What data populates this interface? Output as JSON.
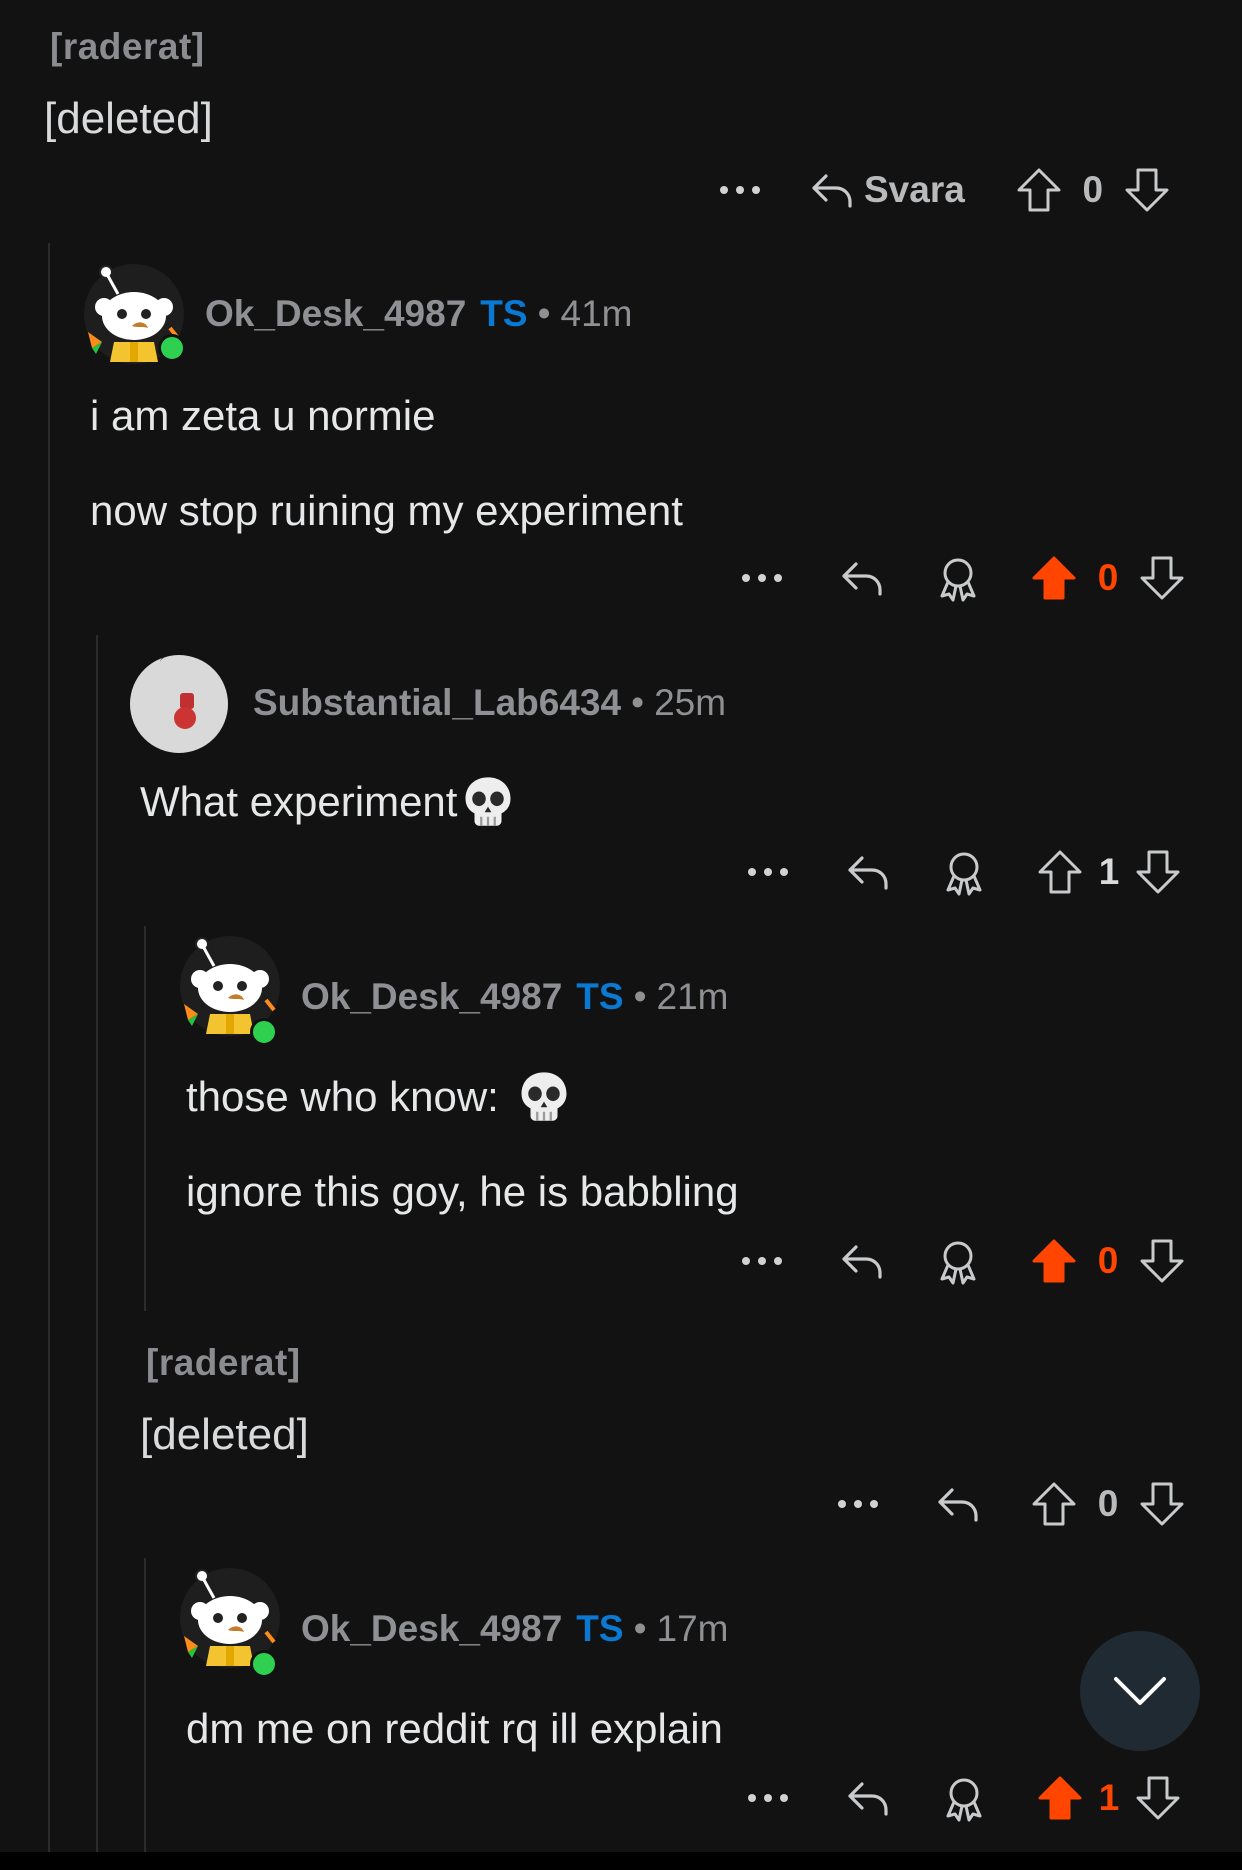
{
  "comments": [
    {
      "author": "[raderat]",
      "body": "[deleted]",
      "reply_label": "Svara",
      "votes": "0"
    },
    {
      "author": "Ok_Desk_4987",
      "op_badge": "TS",
      "time": "41m",
      "body_lines": [
        "i am zeta u normie",
        "now stop ruining my experiment"
      ],
      "votes": "0"
    },
    {
      "author": "Substantial_Lab6434",
      "time": "25m",
      "body_lines": [
        "What experiment"
      ],
      "votes": "1"
    },
    {
      "author": "Ok_Desk_4987",
      "op_badge": "TS",
      "time": "21m",
      "body_lines": [
        "those who know:",
        "ignore this goy, he is babbling"
      ],
      "votes": "0"
    },
    {
      "author": "[raderat]",
      "body": "[deleted]",
      "votes": "0"
    },
    {
      "author": "Ok_Desk_4987",
      "op_badge": "TS",
      "time": "17m",
      "body_lines": [
        "dm me on reddit rq ill explain"
      ],
      "votes": "1"
    }
  ],
  "icons": {
    "more": "more-options-icon",
    "reply": "reply-icon",
    "award": "award-icon",
    "upvote": "upvote-icon",
    "downvote": "downvote-icon",
    "emoji": "skull-emoji",
    "fab": "chevron-down-icon"
  },
  "colors": {
    "upvoted": "#ff4500",
    "op_badge": "#0a79d3",
    "background": "#121212"
  }
}
